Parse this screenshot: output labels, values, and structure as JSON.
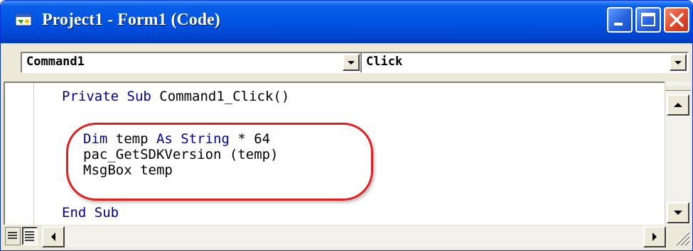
{
  "window": {
    "title": "Project1 - Form1 (Code)"
  },
  "dropdowns": {
    "object_value": "Command1",
    "procedure_value": "Click"
  },
  "code": {
    "lines": [
      {
        "kw1": "Private Sub",
        "rest": " Command1_Click()"
      },
      {
        "kw1": "Dim",
        "mid": " temp ",
        "kw2": "As String",
        "rest": " * 64"
      },
      {
        "text": "pac_GetSDKVersion (temp)"
      },
      {
        "text": "MsgBox temp"
      },
      {
        "kw1": "End Sub"
      }
    ]
  },
  "colors": {
    "titlebar": "#0055e5",
    "keyword": "#00008b",
    "annotation_ellipse": "#e02020",
    "close_button": "#df4a2c"
  },
  "icons": [
    "form-window-icon",
    "minimize-icon",
    "maximize-icon",
    "close-icon",
    "chevron-down-icon",
    "arrow-up-icon",
    "arrow-down-icon",
    "arrow-left-icon",
    "arrow-right-icon",
    "procedure-view-icon",
    "full-module-view-icon",
    "resize-grip-icon"
  ]
}
